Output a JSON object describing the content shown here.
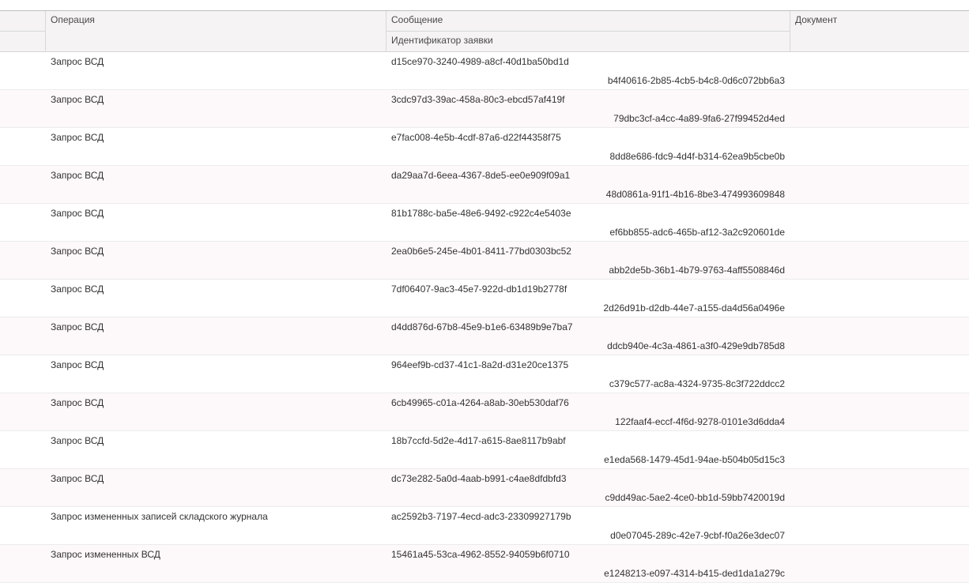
{
  "columns": {
    "operation": "Операция",
    "message": "Сообщение",
    "request_id": "Идентификатор заявки",
    "document": "Документ"
  },
  "rows": [
    {
      "operation": "Запрос ВСД",
      "message": "d15ce970-3240-4989-a8cf-40d1ba50bd1d",
      "request_id": "b4f40616-2b85-4cb5-b4c8-0d6c072bb6a3",
      "document": ""
    },
    {
      "operation": "Запрос ВСД",
      "message": "3cdc97d3-39ac-458a-80c3-ebcd57af419f",
      "request_id": "79dbc3cf-a4cc-4a89-9fa6-27f99452d4ed",
      "document": ""
    },
    {
      "operation": "Запрос ВСД",
      "message": "e7fac008-4e5b-4cdf-87a6-d22f44358f75",
      "request_id": "8dd8e686-fdc9-4d4f-b314-62ea9b5cbe0b",
      "document": ""
    },
    {
      "operation": "Запрос ВСД",
      "message": "da29aa7d-6eea-4367-8de5-ee0e909f09a1",
      "request_id": "48d0861a-91f1-4b16-8be3-474993609848",
      "document": ""
    },
    {
      "operation": "Запрос ВСД",
      "message": "81b1788c-ba5e-48e6-9492-c922c4e5403e",
      "request_id": "ef6bb855-adc6-465b-af12-3a2c920601de",
      "document": ""
    },
    {
      "operation": "Запрос ВСД",
      "message": "2ea0b6e5-245e-4b01-8411-77bd0303bc52",
      "request_id": "abb2de5b-36b1-4b79-9763-4aff5508846d",
      "document": ""
    },
    {
      "operation": "Запрос ВСД",
      "message": "7df06407-9ac3-45e7-922d-db1d19b2778f",
      "request_id": "2d26d91b-d2db-44e7-a155-da4d56a0496e",
      "document": ""
    },
    {
      "operation": "Запрос ВСД",
      "message": "d4dd876d-67b8-45e9-b1e6-63489b9e7ba7",
      "request_id": "ddcb940e-4c3a-4861-a3f0-429e9db785d8",
      "document": ""
    },
    {
      "operation": "Запрос ВСД",
      "message": "964eef9b-cd37-41c1-8a2d-d31e20ce1375",
      "request_id": "c379c577-ac8a-4324-9735-8c3f722ddcc2",
      "document": ""
    },
    {
      "operation": "Запрос ВСД",
      "message": "6cb49965-c01a-4264-a8ab-30eb530daf76",
      "request_id": "122faaf4-eccf-4f6d-9278-0101e3d6dda4",
      "document": ""
    },
    {
      "operation": "Запрос ВСД",
      "message": "18b7ccfd-5d2e-4d17-a615-8ae8117b9abf",
      "request_id": "e1eda568-1479-45d1-94ae-b504b05d15c3",
      "document": ""
    },
    {
      "operation": "Запрос ВСД",
      "message": "dc73e282-5a0d-4aab-b991-c4ae8dfdbfd3",
      "request_id": "c9dd49ac-5ae2-4ce0-bb1d-59bb7420019d",
      "document": ""
    },
    {
      "operation": "Запрос измененных записей складского журнала",
      "message": "ac2592b3-7197-4ecd-adc3-23309927179b",
      "request_id": "d0e07045-289c-42e7-9cbf-f0a26e3dec07",
      "document": ""
    },
    {
      "operation": "Запрос измененных ВСД",
      "message": "15461a45-53ca-4962-8552-94059b6f0710",
      "request_id": "e1248213-e097-4314-b415-ded1da1a279c",
      "document": ""
    }
  ]
}
